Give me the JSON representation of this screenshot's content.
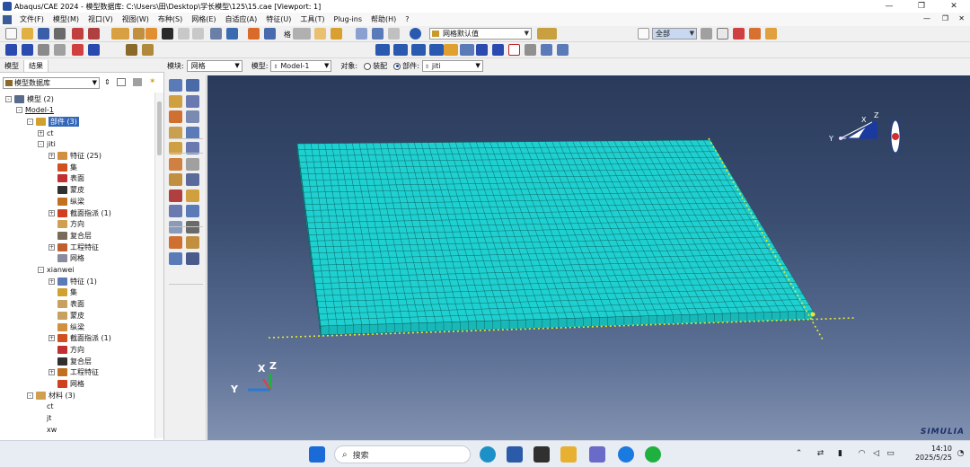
{
  "window": {
    "title": "Abaqus/CAE 2024 - 模型数据库: C:\\Users\\田\\Desktop\\学长模型\\125\\15.cae [Viewport: 1]",
    "minimize": "—",
    "maximize": "❐",
    "close": "✕"
  },
  "menu": {
    "items": [
      "文件(F)",
      "模型(M)",
      "视口(V)",
      "视图(W)",
      "布种(S)",
      "网格(E)",
      "自适应(A)",
      "特征(U)",
      "工具(T)",
      "Plug-ins",
      "帮助(H)",
      "?"
    ],
    "mdi_minimize": "—",
    "mdi_restore": "❐",
    "mdi_close": "✕"
  },
  "toolbar": {
    "mesh_label": "格",
    "render_style": "网格默认值",
    "selection_filter": "全部"
  },
  "context": {
    "module_label": "模块:",
    "module_value": "网格",
    "model_label": "模型:",
    "model_value": "Model-1",
    "object_label": "对象:",
    "object_assembly": "装配",
    "object_part": "部件:",
    "part_value": "jiti"
  },
  "panel": {
    "tabs": [
      "模型",
      "结果"
    ],
    "database": "模型数据库"
  },
  "tree": [
    {
      "label": "模型 (2)",
      "level": 0,
      "exp": "-"
    },
    {
      "label": "Model-1",
      "level": 1,
      "exp": "-",
      "underline": true
    },
    {
      "label": "部件 (3)",
      "level": 2,
      "exp": "-",
      "selected": true
    },
    {
      "label": "ct",
      "level": 3,
      "exp": "+"
    },
    {
      "label": "jiti",
      "level": 3,
      "exp": "-"
    },
    {
      "label": "特征 (25)",
      "level": 4,
      "exp": "+"
    },
    {
      "label": "集",
      "level": 4,
      "exp": ""
    },
    {
      "label": "表面",
      "level": 4,
      "exp": ""
    },
    {
      "label": "蒙皮",
      "level": 4,
      "exp": ""
    },
    {
      "label": "纵梁",
      "level": 4,
      "exp": ""
    },
    {
      "label": "截面指派 (1)",
      "level": 4,
      "exp": "+"
    },
    {
      "label": "方向",
      "level": 4,
      "exp": ""
    },
    {
      "label": "复合层",
      "level": 4,
      "exp": ""
    },
    {
      "label": "工程特征",
      "level": 4,
      "exp": "+"
    },
    {
      "label": "网格",
      "level": 4,
      "exp": ""
    },
    {
      "label": "xianwei",
      "level": 3,
      "exp": "-"
    },
    {
      "label": "特征 (1)",
      "level": 4,
      "exp": "+"
    },
    {
      "label": "集",
      "level": 4,
      "exp": ""
    },
    {
      "label": "表面",
      "level": 4,
      "exp": ""
    },
    {
      "label": "蒙皮",
      "level": 4,
      "exp": ""
    },
    {
      "label": "纵梁",
      "level": 4,
      "exp": ""
    },
    {
      "label": "截面指派 (1)",
      "level": 4,
      "exp": "+"
    },
    {
      "label": "方向",
      "level": 4,
      "exp": ""
    },
    {
      "label": "复合层",
      "level": 4,
      "exp": ""
    },
    {
      "label": "工程特征",
      "level": 4,
      "exp": "+"
    },
    {
      "label": "网格",
      "level": 4,
      "exp": ""
    },
    {
      "label": "材料 (3)",
      "level": 2,
      "exp": "-"
    },
    {
      "label": "ct",
      "level": 3,
      "exp": ""
    },
    {
      "label": "jt",
      "level": 3,
      "exp": ""
    },
    {
      "label": "xw",
      "level": 3,
      "exp": ""
    }
  ],
  "viewport": {
    "triad_x": "X",
    "triad_y": "Y",
    "triad_z": "Z",
    "view_x": "X",
    "view_y": "Y",
    "view_z": "Z",
    "brand": "SIMULIA"
  },
  "taskbar": {
    "search_placeholder": "搜索",
    "time": "14:10",
    "date": "2025/5/25"
  },
  "colors": {
    "mesh_fill": "#1fd0d0",
    "mesh_line": "#0c5c5c",
    "edge_highlight": "#e8e830",
    "viewport_top": "#2a3a5a",
    "viewport_bottom": "#8191b0"
  }
}
